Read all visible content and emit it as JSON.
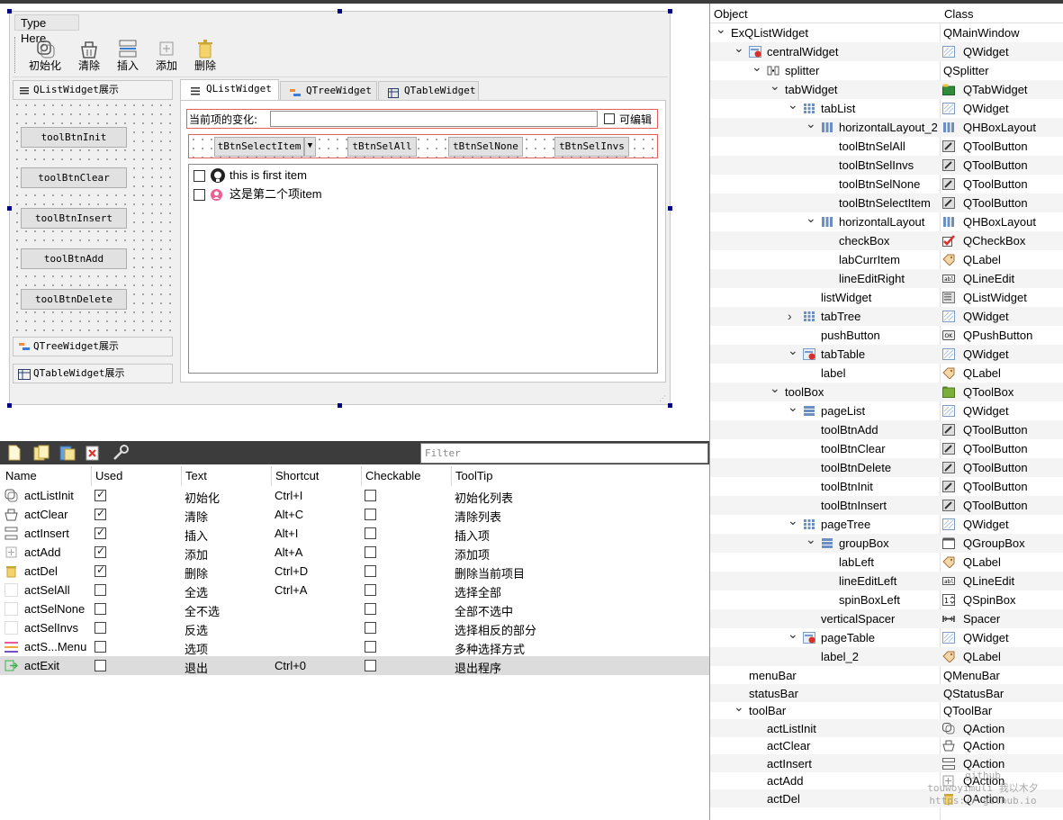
{
  "form": {
    "menu_placeholder": "Type Here",
    "toolbar": [
      {
        "label": "初始化",
        "icon": "init-icon"
      },
      {
        "label": "清除",
        "icon": "clear-icon"
      },
      {
        "label": "插入",
        "icon": "insert-icon"
      },
      {
        "label": "添加",
        "icon": "add-icon"
      },
      {
        "label": "删除",
        "icon": "delete-icon"
      }
    ],
    "toolbox_pages": [
      "QListWidget展示",
      "QTreeWidget展示",
      "QTableWidget展示"
    ],
    "left_buttons": [
      "toolBtnInit",
      "toolBtnClear",
      "toolBtnInsert",
      "toolBtnAdd",
      "toolBtnDelete"
    ],
    "tabs": [
      "QListWidget",
      "QTreeWidget",
      "QTableWidget"
    ],
    "current_item_label": "当前项的变化:",
    "current_item_value": "",
    "editable_label": "可编辑",
    "select_buttons": [
      "tBtnSelectItem",
      "tBtnSelAll",
      "tBtnSelNone",
      "tBtnSelInvs"
    ],
    "list_items": [
      {
        "text": "this is first item",
        "checked": false
      },
      {
        "text": "这是第二个项item",
        "checked": false
      }
    ]
  },
  "action_editor": {
    "filter_placeholder": "Filter",
    "columns": [
      "Name",
      "Used",
      "Text",
      "Shortcut",
      "Checkable",
      "ToolTip"
    ],
    "rows": [
      {
        "name": "actListInit",
        "used": true,
        "text": "初始化",
        "shortcut": "Ctrl+I",
        "checkable": false,
        "tooltip": "初始化列表"
      },
      {
        "name": "actClear",
        "used": true,
        "text": "清除",
        "shortcut": "Alt+C",
        "checkable": false,
        "tooltip": "清除列表"
      },
      {
        "name": "actInsert",
        "used": true,
        "text": "插入",
        "shortcut": "Alt+I",
        "checkable": false,
        "tooltip": "插入项"
      },
      {
        "name": "actAdd",
        "used": true,
        "text": "添加",
        "shortcut": "Alt+A",
        "checkable": false,
        "tooltip": "添加项"
      },
      {
        "name": "actDel",
        "used": true,
        "text": "删除",
        "shortcut": "Ctrl+D",
        "checkable": false,
        "tooltip": "删除当前项目"
      },
      {
        "name": "actSelAll",
        "used": false,
        "text": "全选",
        "shortcut": "Ctrl+A",
        "checkable": false,
        "tooltip": "选择全部"
      },
      {
        "name": "actSelNone",
        "used": false,
        "text": "全不选",
        "shortcut": "",
        "checkable": false,
        "tooltip": "全部不选中"
      },
      {
        "name": "actSelInvs",
        "used": false,
        "text": "反选",
        "shortcut": "",
        "checkable": false,
        "tooltip": "选择相反的部分"
      },
      {
        "name": "actS...Menu",
        "used": false,
        "text": "选项",
        "shortcut": "",
        "checkable": false,
        "tooltip": "多种选择方式"
      },
      {
        "name": "actExit",
        "used": false,
        "text": "退出",
        "shortcut": "Ctrl+0",
        "checkable": false,
        "tooltip": "退出程序",
        "selected": true
      }
    ]
  },
  "inspector": {
    "headers": [
      "Object",
      "Class"
    ],
    "rows": [
      {
        "depth": 0,
        "arrow": "down",
        "name": "ExQListWidget",
        "class": "QMainWindow",
        "icon": "",
        "class_icon": ""
      },
      {
        "depth": 1,
        "arrow": "down",
        "name": "centralWidget",
        "class": "QWidget",
        "icon": "widget-broken-icon",
        "class_icon": "widget-icon"
      },
      {
        "depth": 2,
        "arrow": "down",
        "name": "splitter",
        "class": "QSplitter",
        "icon": "splitter-icon",
        "class_icon": ""
      },
      {
        "depth": 3,
        "arrow": "down",
        "name": "tabWidget",
        "class": "QTabWidget",
        "icon": "",
        "class_icon": "tabwidget-icon"
      },
      {
        "depth": 4,
        "arrow": "down",
        "name": "tabList",
        "class": "QWidget",
        "icon": "grid-layout-icon",
        "class_icon": "widget-icon"
      },
      {
        "depth": 5,
        "arrow": "down",
        "name": "horizontalLayout_2",
        "class": "QHBoxLayout",
        "icon": "hbox-icon",
        "class_icon": "hbox-icon"
      },
      {
        "depth": 6,
        "arrow": "",
        "name": "toolBtnSelAll",
        "class": "QToolButton",
        "icon": "",
        "class_icon": "toolbutton-icon"
      },
      {
        "depth": 6,
        "arrow": "",
        "name": "toolBtnSelInvs",
        "class": "QToolButton",
        "icon": "",
        "class_icon": "toolbutton-icon"
      },
      {
        "depth": 6,
        "arrow": "",
        "name": "toolBtnSelNone",
        "class": "QToolButton",
        "icon": "",
        "class_icon": "toolbutton-icon"
      },
      {
        "depth": 6,
        "arrow": "",
        "name": "toolBtnSelectItem",
        "class": "QToolButton",
        "icon": "",
        "class_icon": "toolbutton-icon"
      },
      {
        "depth": 5,
        "arrow": "down",
        "name": "horizontalLayout",
        "class": "QHBoxLayout",
        "icon": "hbox-icon",
        "class_icon": "hbox-icon"
      },
      {
        "depth": 6,
        "arrow": "",
        "name": "checkBox",
        "class": "QCheckBox",
        "icon": "",
        "class_icon": "checkbox-icon"
      },
      {
        "depth": 6,
        "arrow": "",
        "name": "labCurrItem",
        "class": "QLabel",
        "icon": "",
        "class_icon": "label-icon"
      },
      {
        "depth": 6,
        "arrow": "",
        "name": "lineEditRight",
        "class": "QLineEdit",
        "icon": "",
        "class_icon": "lineedit-icon"
      },
      {
        "depth": 5,
        "arrow": "",
        "name": "listWidget",
        "class": "QListWidget",
        "icon": "",
        "class_icon": "listwidget-icon"
      },
      {
        "depth": 4,
        "arrow": "right",
        "name": "tabTree",
        "class": "QWidget",
        "icon": "grid-layout-icon",
        "class_icon": "widget-icon"
      },
      {
        "depth": 5,
        "arrow": "",
        "name": "pushButton",
        "class": "QPushButton",
        "icon": "",
        "class_icon": "pushbutton-icon"
      },
      {
        "depth": 4,
        "arrow": "down",
        "name": "tabTable",
        "class": "QWidget",
        "icon": "widget-broken-icon",
        "class_icon": "widget-icon"
      },
      {
        "depth": 5,
        "arrow": "",
        "name": "label",
        "class": "QLabel",
        "icon": "",
        "class_icon": "label-icon"
      },
      {
        "depth": 3,
        "arrow": "down",
        "name": "toolBox",
        "class": "QToolBox",
        "icon": "",
        "class_icon": "toolbox-icon"
      },
      {
        "depth": 4,
        "arrow": "down",
        "name": "pageList",
        "class": "QWidget",
        "icon": "vbox-icon",
        "class_icon": "widget-icon"
      },
      {
        "depth": 5,
        "arrow": "",
        "name": "toolBtnAdd",
        "class": "QToolButton",
        "icon": "",
        "class_icon": "toolbutton-icon"
      },
      {
        "depth": 5,
        "arrow": "",
        "name": "toolBtnClear",
        "class": "QToolButton",
        "icon": "",
        "class_icon": "toolbutton-icon"
      },
      {
        "depth": 5,
        "arrow": "",
        "name": "toolBtnDelete",
        "class": "QToolButton",
        "icon": "",
        "class_icon": "toolbutton-icon"
      },
      {
        "depth": 5,
        "arrow": "",
        "name": "toolBtnInit",
        "class": "QToolButton",
        "icon": "",
        "class_icon": "toolbutton-icon"
      },
      {
        "depth": 5,
        "arrow": "",
        "name": "toolBtnInsert",
        "class": "QToolButton",
        "icon": "",
        "class_icon": "toolbutton-icon"
      },
      {
        "depth": 4,
        "arrow": "down",
        "name": "pageTree",
        "class": "QWidget",
        "icon": "grid-layout-icon",
        "class_icon": "widget-icon"
      },
      {
        "depth": 5,
        "arrow": "down",
        "name": "groupBox",
        "class": "QGroupBox",
        "icon": "vbox-icon",
        "class_icon": "groupbox-icon"
      },
      {
        "depth": 6,
        "arrow": "",
        "name": "labLeft",
        "class": "QLabel",
        "icon": "",
        "class_icon": "label-icon"
      },
      {
        "depth": 6,
        "arrow": "",
        "name": "lineEditLeft",
        "class": "QLineEdit",
        "icon": "",
        "class_icon": "lineedit-icon"
      },
      {
        "depth": 6,
        "arrow": "",
        "name": "spinBoxLeft",
        "class": "QSpinBox",
        "icon": "",
        "class_icon": "spinbox-icon"
      },
      {
        "depth": 5,
        "arrow": "",
        "name": "verticalSpacer",
        "class": "Spacer",
        "icon": "",
        "class_icon": "spacer-icon"
      },
      {
        "depth": 4,
        "arrow": "down",
        "name": "pageTable",
        "class": "QWidget",
        "icon": "widget-broken-icon",
        "class_icon": "widget-icon"
      },
      {
        "depth": 5,
        "arrow": "",
        "name": "label_2",
        "class": "QLabel",
        "icon": "",
        "class_icon": "label-icon"
      },
      {
        "depth": 1,
        "arrow": "",
        "name": "menuBar",
        "class": "QMenuBar",
        "icon": "",
        "class_icon": ""
      },
      {
        "depth": 1,
        "arrow": "",
        "name": "statusBar",
        "class": "QStatusBar",
        "icon": "",
        "class_icon": ""
      },
      {
        "depth": 1,
        "arrow": "down",
        "name": "toolBar",
        "class": "QToolBar",
        "icon": "",
        "class_icon": ""
      },
      {
        "depth": 2,
        "arrow": "",
        "name": "actListInit",
        "class": "QAction",
        "icon": "",
        "class_icon": "action-init-icon"
      },
      {
        "depth": 2,
        "arrow": "",
        "name": "actClear",
        "class": "QAction",
        "icon": "",
        "class_icon": "action-clear-icon"
      },
      {
        "depth": 2,
        "arrow": "",
        "name": "actInsert",
        "class": "QAction",
        "icon": "",
        "class_icon": "action-insert-icon"
      },
      {
        "depth": 2,
        "arrow": "",
        "name": "actAdd",
        "class": "QAction",
        "icon": "",
        "class_icon": "action-add-icon"
      },
      {
        "depth": 2,
        "arrow": "",
        "name": "actDel",
        "class": "QAction",
        "icon": "",
        "class_icon": "action-delete-icon"
      }
    ]
  },
  "watermark": [
    "github",
    "touwoyimuli",
    "我以木夕",
    "https://",
    "github.io"
  ]
}
